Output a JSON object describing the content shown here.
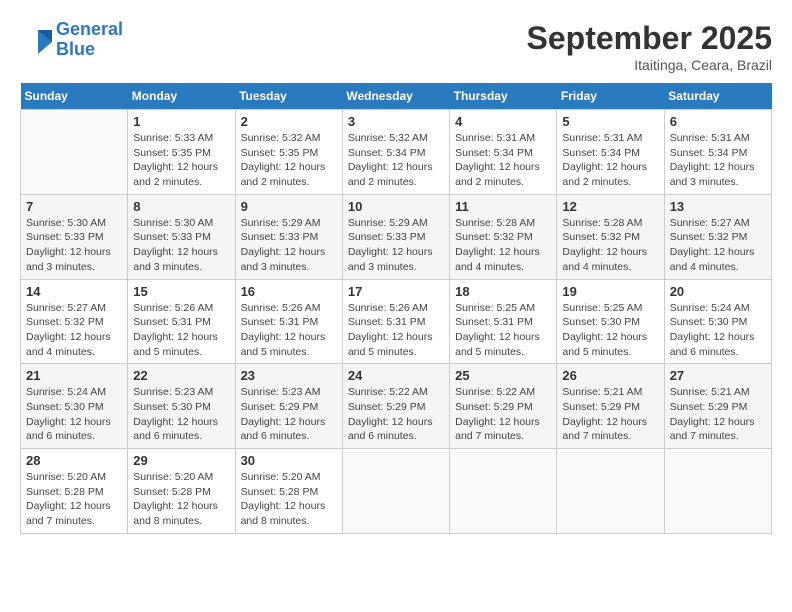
{
  "header": {
    "logo_line1": "General",
    "logo_line2": "Blue",
    "month_title": "September 2025",
    "subtitle": "Itaitinga, Ceara, Brazil"
  },
  "days_of_week": [
    "Sunday",
    "Monday",
    "Tuesday",
    "Wednesday",
    "Thursday",
    "Friday",
    "Saturday"
  ],
  "weeks": [
    [
      {
        "num": "",
        "info": ""
      },
      {
        "num": "1",
        "info": "Sunrise: 5:33 AM\nSunset: 5:35 PM\nDaylight: 12 hours\nand 2 minutes."
      },
      {
        "num": "2",
        "info": "Sunrise: 5:32 AM\nSunset: 5:35 PM\nDaylight: 12 hours\nand 2 minutes."
      },
      {
        "num": "3",
        "info": "Sunrise: 5:32 AM\nSunset: 5:34 PM\nDaylight: 12 hours\nand 2 minutes."
      },
      {
        "num": "4",
        "info": "Sunrise: 5:31 AM\nSunset: 5:34 PM\nDaylight: 12 hours\nand 2 minutes."
      },
      {
        "num": "5",
        "info": "Sunrise: 5:31 AM\nSunset: 5:34 PM\nDaylight: 12 hours\nand 2 minutes."
      },
      {
        "num": "6",
        "info": "Sunrise: 5:31 AM\nSunset: 5:34 PM\nDaylight: 12 hours\nand 3 minutes."
      }
    ],
    [
      {
        "num": "7",
        "info": "Sunrise: 5:30 AM\nSunset: 5:33 PM\nDaylight: 12 hours\nand 3 minutes."
      },
      {
        "num": "8",
        "info": "Sunrise: 5:30 AM\nSunset: 5:33 PM\nDaylight: 12 hours\nand 3 minutes."
      },
      {
        "num": "9",
        "info": "Sunrise: 5:29 AM\nSunset: 5:33 PM\nDaylight: 12 hours\nand 3 minutes."
      },
      {
        "num": "10",
        "info": "Sunrise: 5:29 AM\nSunset: 5:33 PM\nDaylight: 12 hours\nand 3 minutes."
      },
      {
        "num": "11",
        "info": "Sunrise: 5:28 AM\nSunset: 5:32 PM\nDaylight: 12 hours\nand 4 minutes."
      },
      {
        "num": "12",
        "info": "Sunrise: 5:28 AM\nSunset: 5:32 PM\nDaylight: 12 hours\nand 4 minutes."
      },
      {
        "num": "13",
        "info": "Sunrise: 5:27 AM\nSunset: 5:32 PM\nDaylight: 12 hours\nand 4 minutes."
      }
    ],
    [
      {
        "num": "14",
        "info": "Sunrise: 5:27 AM\nSunset: 5:32 PM\nDaylight: 12 hours\nand 4 minutes."
      },
      {
        "num": "15",
        "info": "Sunrise: 5:26 AM\nSunset: 5:31 PM\nDaylight: 12 hours\nand 5 minutes."
      },
      {
        "num": "16",
        "info": "Sunrise: 5:26 AM\nSunset: 5:31 PM\nDaylight: 12 hours\nand 5 minutes."
      },
      {
        "num": "17",
        "info": "Sunrise: 5:26 AM\nSunset: 5:31 PM\nDaylight: 12 hours\nand 5 minutes."
      },
      {
        "num": "18",
        "info": "Sunrise: 5:25 AM\nSunset: 5:31 PM\nDaylight: 12 hours\nand 5 minutes."
      },
      {
        "num": "19",
        "info": "Sunrise: 5:25 AM\nSunset: 5:30 PM\nDaylight: 12 hours\nand 5 minutes."
      },
      {
        "num": "20",
        "info": "Sunrise: 5:24 AM\nSunset: 5:30 PM\nDaylight: 12 hours\nand 6 minutes."
      }
    ],
    [
      {
        "num": "21",
        "info": "Sunrise: 5:24 AM\nSunset: 5:30 PM\nDaylight: 12 hours\nand 6 minutes."
      },
      {
        "num": "22",
        "info": "Sunrise: 5:23 AM\nSunset: 5:30 PM\nDaylight: 12 hours\nand 6 minutes."
      },
      {
        "num": "23",
        "info": "Sunrise: 5:23 AM\nSunset: 5:29 PM\nDaylight: 12 hours\nand 6 minutes."
      },
      {
        "num": "24",
        "info": "Sunrise: 5:22 AM\nSunset: 5:29 PM\nDaylight: 12 hours\nand 6 minutes."
      },
      {
        "num": "25",
        "info": "Sunrise: 5:22 AM\nSunset: 5:29 PM\nDaylight: 12 hours\nand 7 minutes."
      },
      {
        "num": "26",
        "info": "Sunrise: 5:21 AM\nSunset: 5:29 PM\nDaylight: 12 hours\nand 7 minutes."
      },
      {
        "num": "27",
        "info": "Sunrise: 5:21 AM\nSunset: 5:29 PM\nDaylight: 12 hours\nand 7 minutes."
      }
    ],
    [
      {
        "num": "28",
        "info": "Sunrise: 5:20 AM\nSunset: 5:28 PM\nDaylight: 12 hours\nand 7 minutes."
      },
      {
        "num": "29",
        "info": "Sunrise: 5:20 AM\nSunset: 5:28 PM\nDaylight: 12 hours\nand 8 minutes."
      },
      {
        "num": "30",
        "info": "Sunrise: 5:20 AM\nSunset: 5:28 PM\nDaylight: 12 hours\nand 8 minutes."
      },
      {
        "num": "",
        "info": ""
      },
      {
        "num": "",
        "info": ""
      },
      {
        "num": "",
        "info": ""
      },
      {
        "num": "",
        "info": ""
      }
    ]
  ]
}
